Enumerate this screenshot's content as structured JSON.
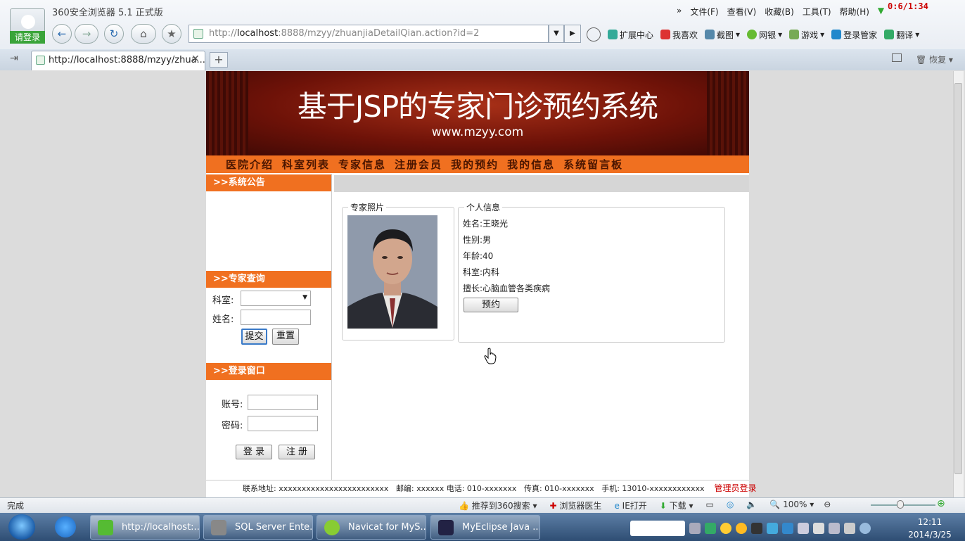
{
  "browser": {
    "window_title": "360安全浏览器 5.1 正式版",
    "login_label": "请登录",
    "menu": [
      "文件(F)",
      "查看(V)",
      "收藏(B)",
      "工具(T)",
      "帮助(H)"
    ],
    "menu_chevron": "»",
    "timer": "0:6/1:34",
    "address_prefix": "http://",
    "address_host": "localhost",
    "address_rest": ":8888/mzyy/zhuanjiaDetailQian.action?id=2",
    "toolbar_items": [
      "扩展中心",
      "我喜欢",
      "截图",
      "网银",
      "游戏",
      "登录管家",
      "翻译"
    ],
    "tab_title": "http://localhost:8888/mzyy/zhua...",
    "restore_label": "恢复",
    "status_text": "完成",
    "status_items": [
      "推荐到360搜索",
      "浏览器医生",
      "IE打开",
      "下载",
      "100%"
    ],
    "accent_color": "#f07020"
  },
  "site": {
    "banner_title": "基于JSP的专家门诊预约系统",
    "banner_url": "www.mzyy.com",
    "nav": [
      "医院介绍",
      "科室列表",
      "专家信息",
      "注册会员",
      "我的预约",
      "我的信息",
      "系统留言板"
    ],
    "notice_header": ">>系统公告",
    "search_header": ">>专家查询",
    "search": {
      "dept_label": "科室:",
      "dept_value": "",
      "name_label": "姓名:",
      "name_value": "",
      "submit_label": "提交",
      "reset_label": "重置"
    },
    "login_header": ">>登录窗口",
    "login": {
      "account_label": "账号:",
      "account_value": "",
      "password_label": "密码:",
      "password_value": "",
      "login_label": "登 录",
      "register_label": "注 册"
    },
    "photo_legend": "专家照片",
    "info_legend": "个人信息",
    "doctor": {
      "name_label": "姓名:",
      "name": "王晓光",
      "gender_label": "性别:",
      "gender": "男",
      "age_label": "年龄:",
      "age": "40",
      "dept_label": "科室:",
      "dept": "内科",
      "specialty_label": "擅长:",
      "specialty": "心脑血管各类疾病"
    },
    "book_label": "预约",
    "footer": {
      "address": "联系地址: xxxxxxxxxxxxxxxxxxxxxxxx",
      "zip": "邮编: xxxxxx",
      "phone": "电话: 010-xxxxxxx",
      "fax": "传真: 010-xxxxxxx",
      "mobile": "手机: 13010-xxxxxxxxxxxx",
      "admin_login": "管理员登录"
    }
  },
  "taskbar": {
    "tasks": [
      "http://localhost:...",
      "SQL Server Ente...",
      "Navicat for MyS...",
      "MyEclipse Java ..."
    ],
    "time": "12:11",
    "date": "2014/3/25"
  }
}
